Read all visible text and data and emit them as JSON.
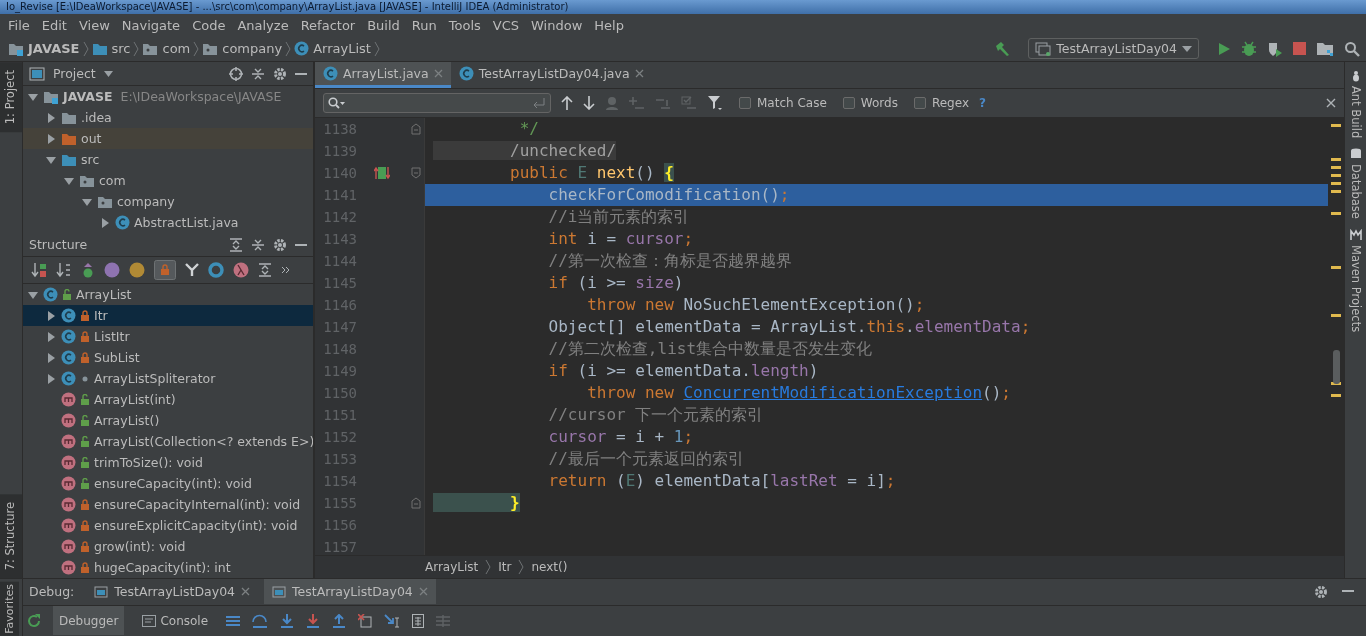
{
  "window": {
    "title": "Io_Revise [E:\\IDeaWorkspace\\JAVASE] - ...\\src\\com\\company\\ArrayList.java [JAVASE] - IntelliJ IDEA (Administrator)"
  },
  "menu": [
    "File",
    "Edit",
    "View",
    "Navigate",
    "Code",
    "Analyze",
    "Refactor",
    "Build",
    "Run",
    "Tools",
    "VCS",
    "Window",
    "Help"
  ],
  "breadcrumbs": [
    {
      "label": "JAVASE",
      "kind": "module"
    },
    {
      "label": "src",
      "kind": "source"
    },
    {
      "label": "com",
      "kind": "package"
    },
    {
      "label": "company",
      "kind": "package"
    },
    {
      "label": "ArrayList",
      "kind": "class"
    }
  ],
  "run_config": {
    "label": "TestArrayListDay04"
  },
  "left_stripe": {
    "project": "1: Project",
    "structure": "7: Structure",
    "favorites": "Favorites"
  },
  "right_stripe": [
    "Ant Build",
    "Database",
    "Maven Projects"
  ],
  "project_panel": {
    "title": "Project",
    "tree": [
      {
        "label": "JAVASE",
        "path": "E:\\IDeaWorkspace\\JAVASE",
        "kind": "module",
        "expanded": true,
        "children": [
          {
            "label": ".idea",
            "kind": "folder",
            "expanded": false
          },
          {
            "label": "out",
            "kind": "excluded",
            "expanded": false
          },
          {
            "label": "src",
            "kind": "source",
            "expanded": true,
            "children": [
              {
                "label": "com",
                "kind": "package",
                "expanded": true,
                "children": [
                  {
                    "label": "company",
                    "kind": "package",
                    "expanded": true,
                    "children": [
                      {
                        "label": "AbstractList.java",
                        "kind": "class",
                        "expanded": false
                      }
                    ]
                  }
                ]
              }
            ]
          }
        ]
      }
    ]
  },
  "structure_panel": {
    "title": "Structure",
    "tree": [
      {
        "label": "ArrayList",
        "kind": "class",
        "access": {
          "kind": "public"
        },
        "expanded": true,
        "selected": false,
        "children": [
          {
            "label": "Itr",
            "kind": "class",
            "access": {
              "kind": "private"
            },
            "expanded": false,
            "selected": true
          },
          {
            "label": "ListItr",
            "kind": "class",
            "access": {
              "kind": "private"
            },
            "expanded": false,
            "selected": false
          },
          {
            "label": "SubList",
            "kind": "class",
            "access": {
              "kind": "private"
            },
            "expanded": false,
            "selected": false
          },
          {
            "label": "ArrayListSpliterator",
            "kind": "class",
            "access": {
              "kind": "package"
            },
            "expanded": false,
            "selected": false
          },
          {
            "label": "ArrayList(int)",
            "kind": "method",
            "access": {
              "kind": "public"
            },
            "selected": false
          },
          {
            "label": "ArrayList()",
            "kind": "method",
            "access": {
              "kind": "public"
            },
            "selected": false
          },
          {
            "label": "ArrayList(Collection<? extends E>)",
            "kind": "method",
            "access": {
              "kind": "public"
            },
            "selected": false
          },
          {
            "label": "trimToSize(): void",
            "kind": "method",
            "access": {
              "kind": "public"
            },
            "selected": false
          },
          {
            "label": "ensureCapacity(int): void",
            "kind": "method",
            "access": {
              "kind": "public"
            },
            "selected": false
          },
          {
            "label": "ensureCapacityInternal(int): void",
            "kind": "method",
            "access": {
              "kind": "private"
            },
            "selected": false
          },
          {
            "label": "ensureExplicitCapacity(int): void",
            "kind": "method",
            "access": {
              "kind": "private"
            },
            "selected": false
          },
          {
            "label": "grow(int): void",
            "kind": "method",
            "access": {
              "kind": "private"
            },
            "selected": false
          },
          {
            "label": "hugeCapacity(int): int",
            "kind": "method",
            "access": {
              "kind": "private"
            },
            "selected": false
          }
        ]
      }
    ]
  },
  "editor_tabs": [
    {
      "label": "ArrayList.java",
      "selected": true
    },
    {
      "label": "TestArrayListDay04.java",
      "selected": false
    }
  ],
  "search": {
    "options": [
      {
        "label": "Match Case",
        "checked": false
      },
      {
        "label": "Words",
        "checked": false
      },
      {
        "label": "Regex",
        "checked": false
      }
    ],
    "help": "?"
  },
  "code": [
    {
      "n": "1138",
      "fold_end": true,
      "highlighted": false,
      "tokens": [
        {
          "kind": "doc",
          "text": "         */"
        }
      ]
    },
    {
      "n": "1139",
      "highlighted": false,
      "tokens": [
        {
          "kind": "annot",
          "text": "        /unchecked/"
        }
      ]
    },
    {
      "n": "1140",
      "fold_start": true,
      "overrides": true,
      "highlighted": false,
      "tokens": [
        {
          "kind": "kw",
          "text": "        public "
        },
        {
          "kind": "tparam",
          "text": "E "
        },
        {
          "kind": "decl",
          "text": "next"
        },
        {
          "kind": "plain",
          "text": "() "
        },
        {
          "kind": "brace",
          "text": "{"
        }
      ]
    },
    {
      "n": "1141",
      "highlighted": true,
      "tokens": [
        {
          "kind": "plain",
          "text": "            checkForComodification()"
        },
        {
          "kind": "kw",
          "text": ";"
        }
      ]
    },
    {
      "n": "1142",
      "highlighted": false,
      "tokens": [
        {
          "kind": "comment",
          "text": "            //i当前元素的索引"
        }
      ]
    },
    {
      "n": "1143",
      "highlighted": false,
      "tokens": [
        {
          "kind": "kw",
          "text": "            int "
        },
        {
          "kind": "plain",
          "text": "i = "
        },
        {
          "kind": "field",
          "text": "cursor"
        },
        {
          "kind": "kw",
          "text": ";"
        }
      ]
    },
    {
      "n": "1144",
      "highlighted": false,
      "tokens": [
        {
          "kind": "comment",
          "text": "            //第一次检查：角标是否越界越界"
        }
      ]
    },
    {
      "n": "1145",
      "highlighted": false,
      "tokens": [
        {
          "kind": "kw",
          "text": "            if "
        },
        {
          "kind": "plain",
          "text": "(i >= "
        },
        {
          "kind": "field",
          "text": "size"
        },
        {
          "kind": "plain",
          "text": ")"
        }
      ]
    },
    {
      "n": "1146",
      "highlighted": false,
      "tokens": [
        {
          "kind": "kw",
          "text": "                throw new "
        },
        {
          "kind": "plain",
          "text": "NoSuchElementException()"
        },
        {
          "kind": "kw",
          "text": ";"
        }
      ]
    },
    {
      "n": "1147",
      "highlighted": false,
      "tokens": [
        {
          "kind": "plain",
          "text": "            Object[] elementData = ArrayList."
        },
        {
          "kind": "kw",
          "text": "this"
        },
        {
          "kind": "plain",
          "text": "."
        },
        {
          "kind": "field",
          "text": "elementData"
        },
        {
          "kind": "kw",
          "text": ";"
        }
      ]
    },
    {
      "n": "1148",
      "highlighted": false,
      "tokens": [
        {
          "kind": "comment",
          "text": "            //第二次检查,list集合中数量是否发生变化"
        }
      ]
    },
    {
      "n": "1149",
      "highlighted": false,
      "tokens": [
        {
          "kind": "kw",
          "text": "            if "
        },
        {
          "kind": "plain",
          "text": "(i >= elementData."
        },
        {
          "kind": "field",
          "text": "length"
        },
        {
          "kind": "plain",
          "text": ")"
        }
      ]
    },
    {
      "n": "1150",
      "highlighted": false,
      "tokens": [
        {
          "kind": "kw",
          "text": "                throw new "
        },
        {
          "kind": "link",
          "text": "ConcurrentModificationException"
        },
        {
          "kind": "plain",
          "text": "()"
        },
        {
          "kind": "kw",
          "text": ";"
        }
      ]
    },
    {
      "n": "1151",
      "highlighted": false,
      "tokens": [
        {
          "kind": "comment",
          "text": "            //cursor 下一个元素的索引"
        }
      ]
    },
    {
      "n": "1152",
      "highlighted": false,
      "tokens": [
        {
          "kind": "field",
          "text": "            cursor"
        },
        {
          "kind": "plain",
          "text": " = i + "
        },
        {
          "kind": "num",
          "text": "1"
        },
        {
          "kind": "kw",
          "text": ";"
        }
      ]
    },
    {
      "n": "1153",
      "highlighted": false,
      "tokens": [
        {
          "kind": "comment",
          "text": "            //最后一个元素返回的索引"
        }
      ]
    },
    {
      "n": "1154",
      "highlighted": false,
      "tokens": [
        {
          "kind": "kw",
          "text": "            return "
        },
        {
          "kind": "plain",
          "text": "("
        },
        {
          "kind": "tparam",
          "text": "E"
        },
        {
          "kind": "plain",
          "text": ") elementData["
        },
        {
          "kind": "field",
          "text": "lastRet"
        },
        {
          "kind": "plain",
          "text": " = i]"
        },
        {
          "kind": "kw",
          "text": ";"
        }
      ]
    },
    {
      "n": "1155",
      "fold_end": true,
      "highlighted": false,
      "tokens": [
        {
          "kind": "brace",
          "text": "        }"
        }
      ]
    },
    {
      "n": "1156"
    },
    {
      "n": "1157"
    }
  ],
  "editor_breadcrumbs": [
    "ArrayList",
    "Itr",
    "next()"
  ],
  "debug": {
    "label": "Debug:",
    "sessions": [
      {
        "label": "TestArrayListDay04",
        "selected": false
      },
      {
        "label": "TestArrayListDay04",
        "selected": true
      }
    ],
    "tabs": [
      {
        "label": "Debugger",
        "selected": true
      },
      {
        "label": "Console",
        "selected": false
      }
    ]
  }
}
